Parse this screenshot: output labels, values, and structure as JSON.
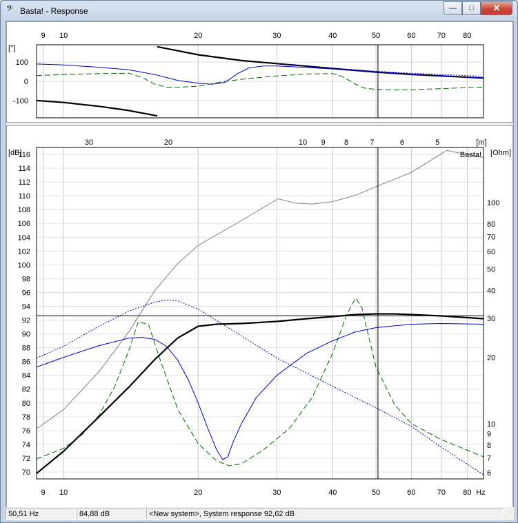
{
  "window": {
    "icon": "bass-clef-icon",
    "icon_glyph": "𝄢",
    "title": "Basta! - Response",
    "minimize": "—",
    "maximize": "□",
    "close": "✕"
  },
  "status": {
    "freq": "50,51 Hz",
    "level": "84,88 dB",
    "info": "<New system>, System response 92,62 dB"
  },
  "phase_panel": {
    "unit_label": "[°]",
    "freq_ticks": [
      {
        "label": "9",
        "f": 9
      },
      {
        "label": "10",
        "f": 10
      },
      {
        "label": "20",
        "f": 20
      },
      {
        "label": "30",
        "f": 30
      },
      {
        "label": "40",
        "f": 40
      },
      {
        "label": "50",
        "f": 50
      },
      {
        "label": "60",
        "f": 60
      },
      {
        "label": "70",
        "f": 70
      },
      {
        "label": "80",
        "f": 80
      }
    ],
    "y_ticks": [
      {
        "label": "100",
        "v": 100
      },
      {
        "label": "0",
        "v": 0
      },
      {
        "label": "-100",
        "v": -100
      }
    ],
    "cursor_freq": 50.51
  },
  "main_panel": {
    "left_unit": "[dB]",
    "right_unit": "[Ohm]",
    "top_unit": "[m]",
    "hz_label": "Hz",
    "watermark": "Basta!",
    "db_ticks": [
      "116",
      "114",
      "112",
      "110",
      "108",
      "106",
      "104",
      "102",
      "100",
      "98",
      "96",
      "94",
      "92",
      "90",
      "88",
      "86",
      "84",
      "82",
      "80",
      "78",
      "76",
      "74",
      "72",
      "70"
    ],
    "ohm_ticks": [
      {
        "label": "100",
        "v": 100
      },
      {
        "label": "80",
        "v": 80
      },
      {
        "label": "70",
        "v": 70
      },
      {
        "label": "60",
        "v": 60
      },
      {
        "label": "50",
        "v": 50
      },
      {
        "label": "40",
        "v": 40
      },
      {
        "label": "30",
        "v": 30
      },
      {
        "label": "20",
        "v": 20
      },
      {
        "label": "10",
        "v": 10
      },
      {
        "label": "9",
        "v": 9
      },
      {
        "label": "8",
        "v": 8
      },
      {
        "label": "7",
        "v": 7
      },
      {
        "label": "6",
        "v": 6
      }
    ],
    "wavelength_ticks": [
      {
        "label": "30",
        "f": 11.4
      },
      {
        "label": "20",
        "f": 17.15
      },
      {
        "label": "10",
        "f": 34.3
      },
      {
        "label": "9",
        "f": 38.1
      },
      {
        "label": "8",
        "f": 42.9
      },
      {
        "label": "7",
        "f": 49.0
      },
      {
        "label": "6",
        "f": 57.2
      },
      {
        "label": "5",
        "f": 68.6
      }
    ],
    "freq_ticks": [
      {
        "label": "9",
        "f": 9
      },
      {
        "label": "10",
        "f": 10
      },
      {
        "label": "20",
        "f": 20
      },
      {
        "label": "30",
        "f": 30
      },
      {
        "label": "40",
        "f": 40
      },
      {
        "label": "50",
        "f": 50
      },
      {
        "label": "60",
        "f": 60
      },
      {
        "label": "70",
        "f": 70
      },
      {
        "label": "80",
        "f": 80
      }
    ],
    "cursor_freq": 50.51,
    "cursor_db": 92.62
  },
  "chart_data": [
    {
      "type": "line",
      "x_scale": "log",
      "xlim": [
        8.7,
        87
      ],
      "ylim": [
        -190,
        190
      ],
      "ylabel": "[°]",
      "series": [
        {
          "color": "#000000",
          "style": "bold",
          "x": [
            8.7,
            10,
            12,
            14,
            16.2
          ],
          "y": [
            -100,
            -110,
            -130,
            -152,
            -180
          ]
        },
        {
          "color": "#000000",
          "style": "bold",
          "x": [
            16.2,
            20,
            25,
            30,
            40,
            50,
            60,
            70,
            87
          ],
          "y": [
            180,
            138,
            108,
            92,
            67,
            48,
            36,
            28,
            17
          ]
        },
        {
          "color": "#0000cc",
          "style": "solid",
          "x": [
            8.7,
            10,
            12,
            14,
            16,
            18,
            20,
            21.5,
            23,
            24.5,
            26,
            28,
            30,
            35,
            40,
            45,
            50,
            60,
            70,
            87
          ],
          "y": [
            90,
            85,
            73,
            60,
            35,
            5,
            -10,
            -15,
            -5,
            40,
            70,
            80,
            80,
            72,
            64,
            55,
            48,
            35,
            27,
            18
          ]
        },
        {
          "color": "#006600",
          "style": "dash",
          "x": [
            8.7,
            10,
            12,
            14,
            15,
            16,
            17,
            18,
            20,
            23,
            26,
            30,
            35,
            40,
            42,
            45,
            47,
            50,
            55,
            60,
            70,
            87
          ],
          "y": [
            30,
            35,
            40,
            42,
            20,
            -15,
            -30,
            -32,
            -25,
            0,
            15,
            28,
            38,
            40,
            25,
            -15,
            -35,
            -42,
            -45,
            -44,
            -38,
            -30
          ]
        },
        {
          "color": "#0000cc",
          "style": "dot",
          "x": [
            30,
            40,
            50,
            60,
            70,
            87
          ],
          "y": [
            90,
            68,
            52,
            42,
            35,
            26
          ]
        }
      ]
    },
    {
      "type": "line",
      "x_scale": "log",
      "xlim": [
        8.7,
        87
      ],
      "ylim": [
        69,
        117
      ],
      "xlabel": "Hz",
      "ylabel": "[dB]",
      "y2label": "[Ohm]",
      "series": [
        {
          "axis": "dB",
          "color": "#000000",
          "style": "bold",
          "x": [
            8.7,
            10,
            12,
            14,
            16,
            18,
            20,
            22,
            25,
            30,
            35,
            40,
            45,
            50,
            55,
            60,
            70,
            87
          ],
          "y": [
            69.8,
            73,
            78,
            82.3,
            86.3,
            89.4,
            91.1,
            91.4,
            91.5,
            91.8,
            92.2,
            92.5,
            92.8,
            92.9,
            92.9,
            92.8,
            92.6,
            92.2
          ]
        },
        {
          "axis": "dB",
          "color": "#0000cc",
          "style": "solid",
          "x": [
            8.7,
            10,
            12,
            14,
            15,
            16,
            17,
            18,
            19,
            20,
            21,
            22,
            22.7,
            23.3,
            24,
            25,
            27,
            30,
            35,
            40,
            45,
            50,
            60,
            70,
            87
          ],
          "y": [
            85.2,
            86.6,
            88.3,
            89.4,
            89.5,
            89.2,
            88.2,
            86.2,
            83.4,
            80,
            76.4,
            73.2,
            71.8,
            72.2,
            74.5,
            77,
            80.8,
            84,
            87.2,
            89,
            90.3,
            90.9,
            91.4,
            91.5,
            91.4
          ]
        },
        {
          "axis": "dB",
          "color": "#000099",
          "style": "dot",
          "x": [
            8.7,
            10,
            12,
            14,
            16,
            17,
            18,
            20,
            25,
            30,
            40,
            50,
            60,
            70,
            87
          ],
          "y": [
            86.5,
            88.2,
            91.1,
            93.3,
            94.6,
            94.9,
            94.8,
            93.6,
            89.7,
            86.5,
            82.4,
            79.3,
            76.6,
            73.6,
            69.6
          ]
        },
        {
          "axis": "dB",
          "color": "#006600",
          "style": "dash",
          "x": [
            8.7,
            10,
            11,
            12,
            13,
            14,
            14.7,
            15.5,
            16.5,
            18,
            20,
            22,
            23.5,
            25,
            28,
            32,
            36,
            40,
            43,
            45,
            46.5,
            48,
            50,
            55,
            60,
            70,
            87
          ],
          "y": [
            71.9,
            73.4,
            75.4,
            78.2,
            82.3,
            87.6,
            91.8,
            91.3,
            86,
            79.1,
            74.1,
            71.6,
            70.9,
            71.2,
            73.2,
            76.3,
            80.8,
            87.2,
            92.8,
            95.2,
            93.8,
            90,
            85.2,
            79.8,
            77,
            74.7,
            72.2
          ]
        },
        {
          "axis": "Ohm",
          "color": "#808080",
          "style": "thin",
          "x": [
            8.7,
            10,
            12,
            14,
            16,
            18,
            20,
            25,
            30.2,
            33,
            36,
            40,
            45,
            50,
            60,
            72,
            80,
            87
          ],
          "y": [
            9.48,
            11.6,
            17.2,
            26.1,
            40,
            53,
            64,
            83,
            104,
            99.5,
            98.5,
            101,
            108,
            118,
            137,
            172,
            165,
            160
          ]
        }
      ]
    }
  ]
}
